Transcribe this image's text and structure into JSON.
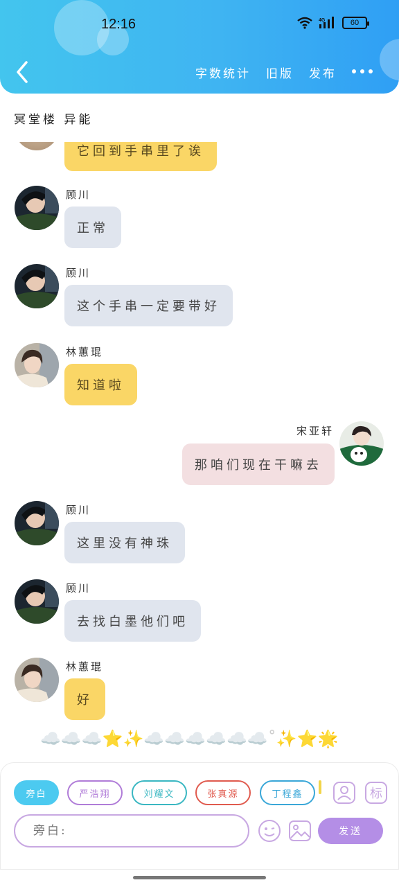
{
  "status": {
    "time": "12:16",
    "network": "4G",
    "battery": "60"
  },
  "header": {
    "actions": [
      "字数统计",
      "旧版",
      "发布"
    ],
    "icons": {
      "back": "chevron-left-icon",
      "more": "more-dots-icon"
    }
  },
  "chat": {
    "title": "冥堂楼 异能",
    "messages": [
      {
        "sender": "",
        "text": "它回到手串里了诶",
        "side": "left",
        "color": "yellow"
      },
      {
        "sender": "顾川",
        "text": "正常",
        "side": "left",
        "color": "grey"
      },
      {
        "sender": "顾川",
        "text": "这个手串一定要带好",
        "side": "left",
        "color": "grey"
      },
      {
        "sender": "林蕙琨",
        "text": "知道啦",
        "side": "left",
        "color": "yellow"
      },
      {
        "sender": "宋亚轩",
        "text": "那咱们现在干嘛去",
        "side": "right",
        "color": "pink"
      },
      {
        "sender": "顾川",
        "text": "这里没有神珠",
        "side": "left",
        "color": "grey"
      },
      {
        "sender": "顾川",
        "text": "去找白墨他们吧",
        "side": "left",
        "color": "grey"
      },
      {
        "sender": "林蕙琨",
        "text": "好",
        "side": "left",
        "color": "yellow"
      }
    ],
    "emoji_line": "☁️☁️☁️⭐✨☁️☁️☁️☁️☁️☁️˚✨⭐🌟"
  },
  "composer": {
    "chips": [
      {
        "label": "旁白",
        "color": "#4ccaf0",
        "filled": true
      },
      {
        "label": "严浩翔",
        "color": "#b07cd8",
        "filled": false
      },
      {
        "label": "刘耀文",
        "color": "#3ab7c2",
        "filled": false
      },
      {
        "label": "张真源",
        "color": "#e05a4e",
        "filled": false
      },
      {
        "label": "丁程鑫",
        "color": "#3aa7d8",
        "filled": false
      }
    ],
    "tag_label": "标",
    "input_placeholder": "旁白:",
    "send_label": "发送",
    "icons": [
      "person-card-icon",
      "tag-icon",
      "emoji-icon",
      "image-icon"
    ]
  },
  "colors": {
    "accent": "#43c5ee",
    "yellow": "#fad666",
    "grey": "#e0e5ee",
    "pink": "#f3dfe1",
    "send": "#b48ee6"
  }
}
